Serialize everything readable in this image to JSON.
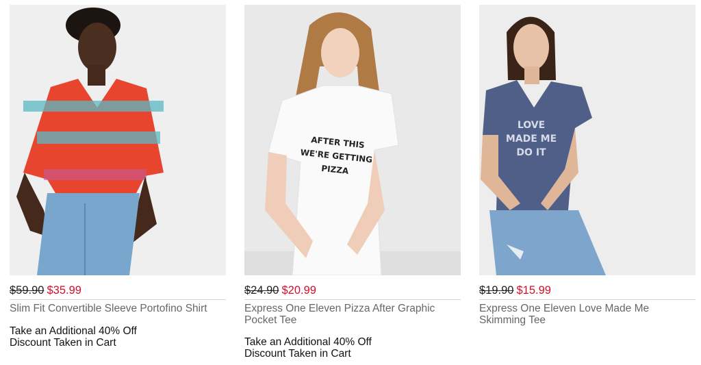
{
  "products": [
    {
      "original_price": "$59.90",
      "sale_price": "$35.99",
      "name": "Slim Fit Convertible Sleeve Portofino Shirt",
      "promo_line1": "Take an Additional 40% Off",
      "promo_line2": "Discount Taken in Cart"
    },
    {
      "original_price": "$24.90",
      "sale_price": "$20.99",
      "name": "Express One Eleven Pizza After Graphic Pocket Tee",
      "promo_line1": "Take an Additional 40% Off",
      "promo_line2": "Discount Taken in Cart",
      "shirt_graphic": [
        "AFTER THIS",
        "WE'RE GETTING",
        "PIZZA"
      ]
    },
    {
      "original_price": "$19.90",
      "sale_price": "$15.99",
      "name": "Express One Eleven Love Made Me Skimming Tee",
      "shirt_graphic": [
        "LOVE",
        "MADE ME",
        "DO IT"
      ]
    }
  ],
  "colors": {
    "sale": "#d0102b",
    "name": "#666666",
    "rule": "#d4d4d4"
  }
}
